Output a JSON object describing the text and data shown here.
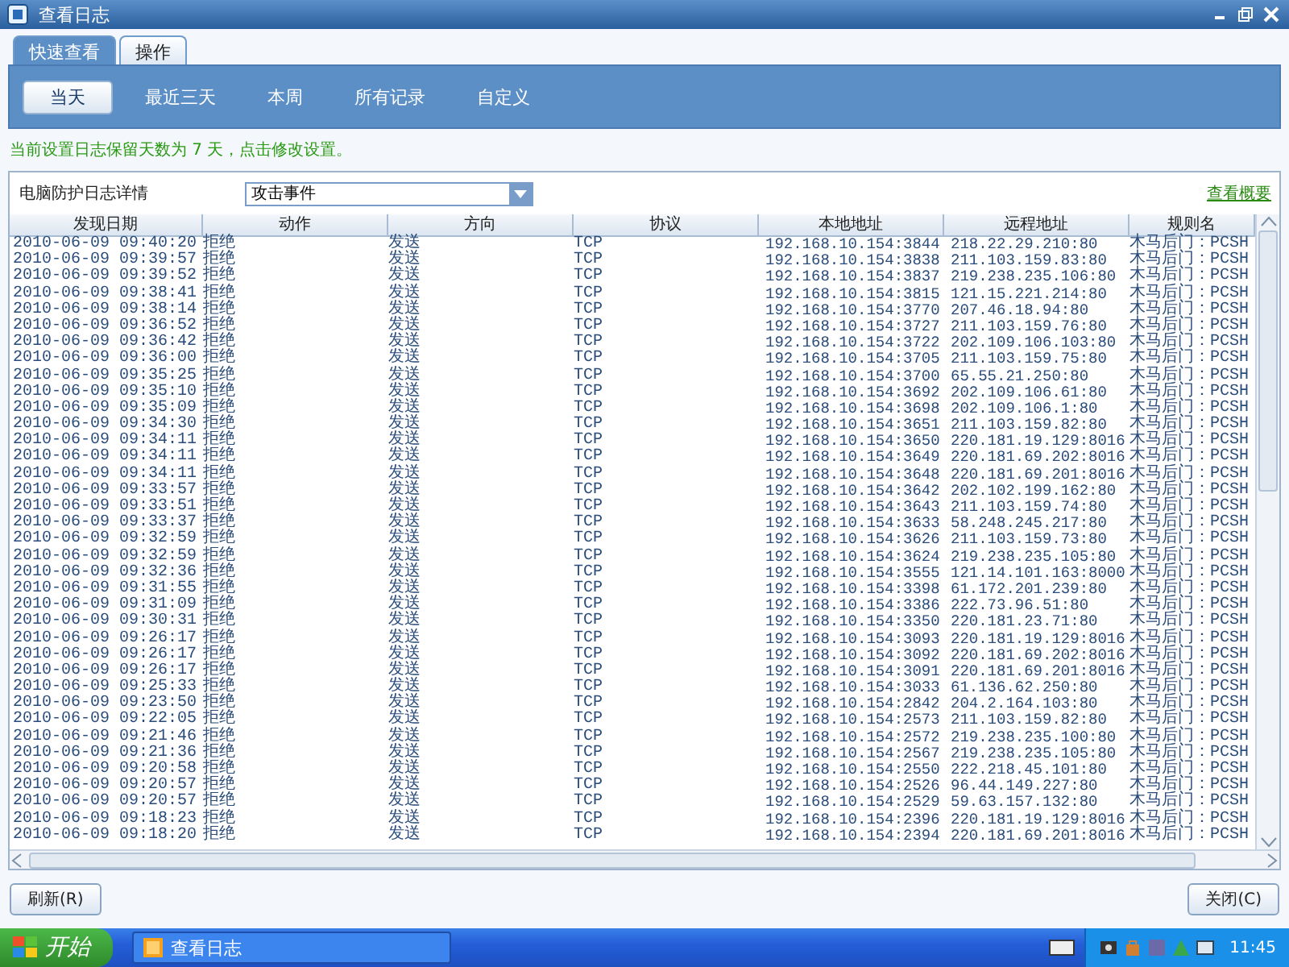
{
  "window": {
    "title": "查看日志"
  },
  "tabs": [
    {
      "label": "快速查看",
      "selected": true
    },
    {
      "label": "操作",
      "selected": false
    }
  ],
  "filters": [
    {
      "label": "当天",
      "selected": true
    },
    {
      "label": "最近三天",
      "selected": false
    },
    {
      "label": "本周",
      "selected": false
    },
    {
      "label": "所有记录",
      "selected": false
    },
    {
      "label": "自定义",
      "selected": false
    }
  ],
  "notice": "当前设置日志保留天数为 7 天，点击修改设置。",
  "log_panel": {
    "label": "电脑防护日志详情",
    "type_select": {
      "value": "攻击事件"
    },
    "summary_link": "查看概要"
  },
  "table": {
    "columns": [
      "发现日期",
      "动作",
      "方向",
      "协议",
      "本地地址",
      "远程地址",
      "规则名"
    ],
    "rows": [
      [
        "2010-06-09 09:40:20",
        "拒绝",
        "发送",
        "TCP",
        "192.168.10.154:3844",
        "218.22.29.210:80",
        "木马后门：PCSH"
      ],
      [
        "2010-06-09 09:39:57",
        "拒绝",
        "发送",
        "TCP",
        "192.168.10.154:3838",
        "211.103.159.83:80",
        "木马后门：PCSH"
      ],
      [
        "2010-06-09 09:39:52",
        "拒绝",
        "发送",
        "TCP",
        "192.168.10.154:3837",
        "219.238.235.106:80",
        "木马后门：PCSH"
      ],
      [
        "2010-06-09 09:38:41",
        "拒绝",
        "发送",
        "TCP",
        "192.168.10.154:3815",
        "121.15.221.214:80",
        "木马后门：PCSH"
      ],
      [
        "2010-06-09 09:38:14",
        "拒绝",
        "发送",
        "TCP",
        "192.168.10.154:3770",
        "207.46.18.94:80",
        "木马后门：PCSH"
      ],
      [
        "2010-06-09 09:36:52",
        "拒绝",
        "发送",
        "TCP",
        "192.168.10.154:3727",
        "211.103.159.76:80",
        "木马后门：PCSH"
      ],
      [
        "2010-06-09 09:36:42",
        "拒绝",
        "发送",
        "TCP",
        "192.168.10.154:3722",
        "202.109.106.103:80",
        "木马后门：PCSH"
      ],
      [
        "2010-06-09 09:36:00",
        "拒绝",
        "发送",
        "TCP",
        "192.168.10.154:3705",
        "211.103.159.75:80",
        "木马后门：PCSH"
      ],
      [
        "2010-06-09 09:35:25",
        "拒绝",
        "发送",
        "TCP",
        "192.168.10.154:3700",
        "65.55.21.250:80",
        "木马后门：PCSH"
      ],
      [
        "2010-06-09 09:35:10",
        "拒绝",
        "发送",
        "TCP",
        "192.168.10.154:3692",
        "202.109.106.61:80",
        "木马后门：PCSH"
      ],
      [
        "2010-06-09 09:35:09",
        "拒绝",
        "发送",
        "TCP",
        "192.168.10.154:3698",
        "202.109.106.1:80",
        "木马后门：PCSH"
      ],
      [
        "2010-06-09 09:34:30",
        "拒绝",
        "发送",
        "TCP",
        "192.168.10.154:3651",
        "211.103.159.82:80",
        "木马后门：PCSH"
      ],
      [
        "2010-06-09 09:34:11",
        "拒绝",
        "发送",
        "TCP",
        "192.168.10.154:3650",
        "220.181.19.129:8016",
        "木马后门：PCSH"
      ],
      [
        "2010-06-09 09:34:11",
        "拒绝",
        "发送",
        "TCP",
        "192.168.10.154:3649",
        "220.181.69.202:8016",
        "木马后门：PCSH"
      ],
      [
        "2010-06-09 09:34:11",
        "拒绝",
        "发送",
        "TCP",
        "192.168.10.154:3648",
        "220.181.69.201:8016",
        "木马后门：PCSH"
      ],
      [
        "2010-06-09 09:33:57",
        "拒绝",
        "发送",
        "TCP",
        "192.168.10.154:3642",
        "202.102.199.162:80",
        "木马后门：PCSH"
      ],
      [
        "2010-06-09 09:33:51",
        "拒绝",
        "发送",
        "TCP",
        "192.168.10.154:3643",
        "211.103.159.74:80",
        "木马后门：PCSH"
      ],
      [
        "2010-06-09 09:33:37",
        "拒绝",
        "发送",
        "TCP",
        "192.168.10.154:3633",
        "58.248.245.217:80",
        "木马后门：PCSH"
      ],
      [
        "2010-06-09 09:32:59",
        "拒绝",
        "发送",
        "TCP",
        "192.168.10.154:3626",
        "211.103.159.73:80",
        "木马后门：PCSH"
      ],
      [
        "2010-06-09 09:32:59",
        "拒绝",
        "发送",
        "TCP",
        "192.168.10.154:3624",
        "219.238.235.105:80",
        "木马后门：PCSH"
      ],
      [
        "2010-06-09 09:32:36",
        "拒绝",
        "发送",
        "TCP",
        "192.168.10.154:3555",
        "121.14.101.163:8000",
        "木马后门：PCSH"
      ],
      [
        "2010-06-09 09:31:55",
        "拒绝",
        "发送",
        "TCP",
        "192.168.10.154:3398",
        "61.172.201.239:80",
        "木马后门：PCSH"
      ],
      [
        "2010-06-09 09:31:09",
        "拒绝",
        "发送",
        "TCP",
        "192.168.10.154:3386",
        "222.73.96.51:80",
        "木马后门：PCSH"
      ],
      [
        "2010-06-09 09:30:31",
        "拒绝",
        "发送",
        "TCP",
        "192.168.10.154:3350",
        "220.181.23.71:80",
        "木马后门：PCSH"
      ],
      [
        "2010-06-09 09:26:17",
        "拒绝",
        "发送",
        "TCP",
        "192.168.10.154:3093",
        "220.181.19.129:8016",
        "木马后门：PCSH"
      ],
      [
        "2010-06-09 09:26:17",
        "拒绝",
        "发送",
        "TCP",
        "192.168.10.154:3092",
        "220.181.69.202:8016",
        "木马后门：PCSH"
      ],
      [
        "2010-06-09 09:26:17",
        "拒绝",
        "发送",
        "TCP",
        "192.168.10.154:3091",
        "220.181.69.201:8016",
        "木马后门：PCSH"
      ],
      [
        "2010-06-09 09:25:33",
        "拒绝",
        "发送",
        "TCP",
        "192.168.10.154:3033",
        "61.136.62.250:80",
        "木马后门：PCSH"
      ],
      [
        "2010-06-09 09:23:50",
        "拒绝",
        "发送",
        "TCP",
        "192.168.10.154:2842",
        "204.2.164.103:80",
        "木马后门：PCSH"
      ],
      [
        "2010-06-09 09:22:05",
        "拒绝",
        "发送",
        "TCP",
        "192.168.10.154:2573",
        "211.103.159.82:80",
        "木马后门：PCSH"
      ],
      [
        "2010-06-09 09:21:46",
        "拒绝",
        "发送",
        "TCP",
        "192.168.10.154:2572",
        "219.238.235.100:80",
        "木马后门：PCSH"
      ],
      [
        "2010-06-09 09:21:36",
        "拒绝",
        "发送",
        "TCP",
        "192.168.10.154:2567",
        "219.238.235.105:80",
        "木马后门：PCSH"
      ],
      [
        "2010-06-09 09:20:58",
        "拒绝",
        "发送",
        "TCP",
        "192.168.10.154:2550",
        "222.218.45.101:80",
        "木马后门：PCSH"
      ],
      [
        "2010-06-09 09:20:57",
        "拒绝",
        "发送",
        "TCP",
        "192.168.10.154:2526",
        "96.44.149.227:80",
        "木马后门：PCSH"
      ],
      [
        "2010-06-09 09:20:57",
        "拒绝",
        "发送",
        "TCP",
        "192.168.10.154:2529",
        "59.63.157.132:80",
        "木马后门：PCSH"
      ],
      [
        "2010-06-09 09:18:23",
        "拒绝",
        "发送",
        "TCP",
        "192.168.10.154:2396",
        "220.181.19.129:8016",
        "木马后门：PCSH"
      ],
      [
        "2010-06-09 09:18:20",
        "拒绝",
        "发送",
        "TCP",
        "192.168.10.154:2394",
        "220.181.69.201:8016",
        "木马后门：PCSH"
      ]
    ]
  },
  "buttons": [
    {
      "label": "刷新(R)",
      "kind": "left"
    },
    {
      "label": "关闭(C)",
      "kind": "right"
    }
  ],
  "taskbar": {
    "start": "开始",
    "task": "查看日志",
    "clock": "11:45"
  }
}
